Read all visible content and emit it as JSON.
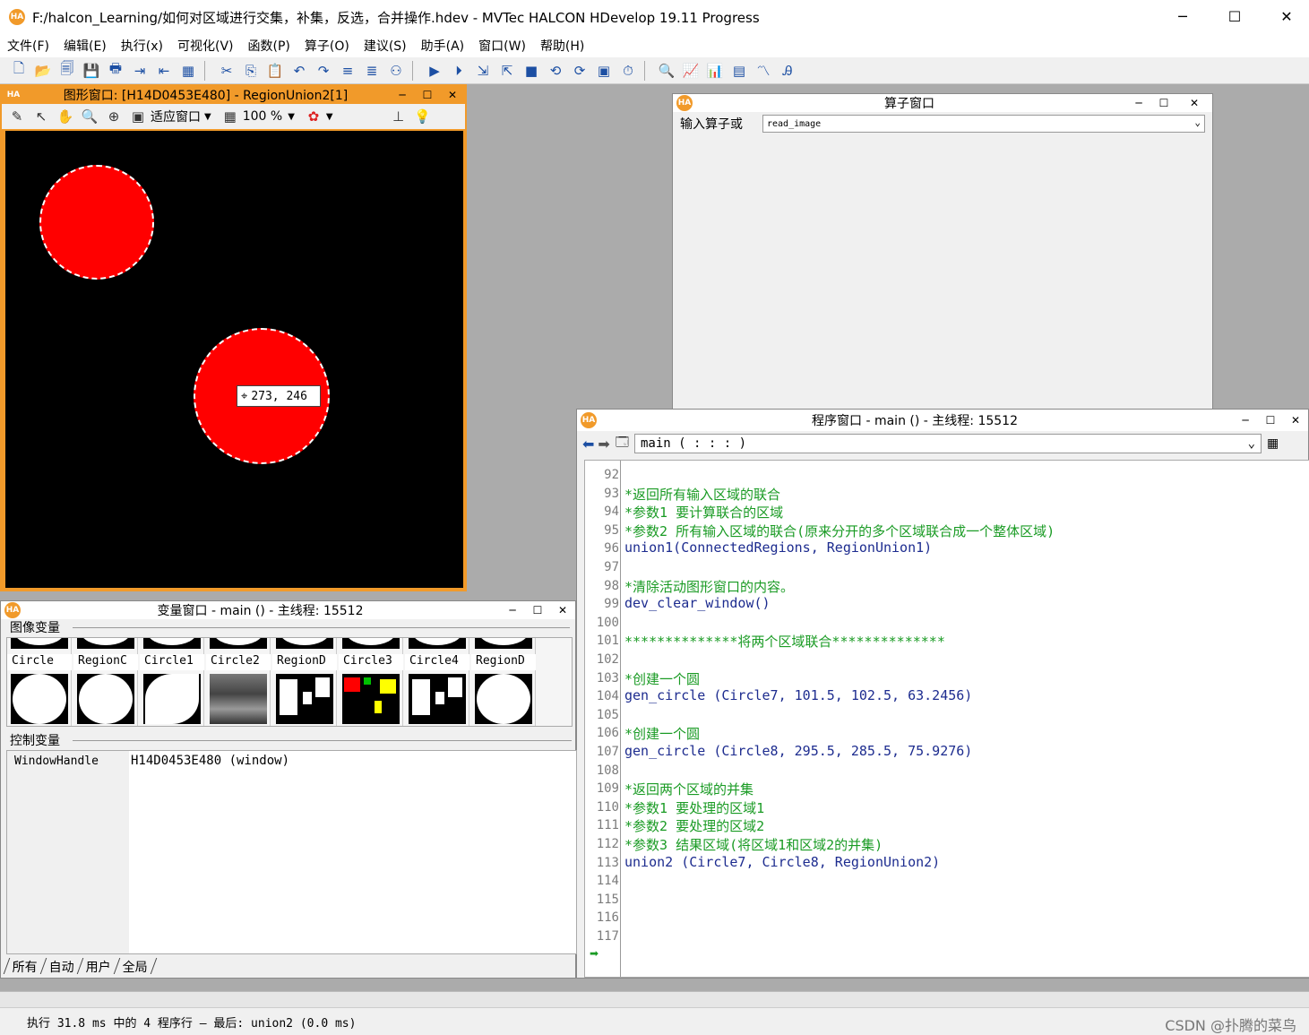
{
  "app": {
    "title": "F:/halcon_Learning/如何对区域进行交集，补集，反选，合并操作.hdev - MVTec HALCON HDevelop 19.11 Progress",
    "logo": "HA",
    "minimize": "─",
    "maximize": "☐",
    "close": "✕"
  },
  "menu": [
    "文件(F)",
    "编辑(E)",
    "执行(x)",
    "可视化(V)",
    "函数(P)",
    "算子(O)",
    "建议(S)",
    "助手(A)",
    "窗口(W)",
    "帮助(H)"
  ],
  "graphics_window": {
    "title": "图形窗口: [H14D0453E480] - RegionUnion2[1]",
    "fit_label": "适应窗口",
    "zoom_label": "100 %",
    "coordinate": "273, 246"
  },
  "operator_window": {
    "title": "算子窗口",
    "input_label": "输入算子或",
    "input_value": "read_image"
  },
  "program_window": {
    "title": "程序窗口 - main () - 主线程: 15512",
    "procedure": "main ( : : : )",
    "lines": [
      {
        "n": "92",
        "text": "",
        "kind": "code"
      },
      {
        "n": "93",
        "text": "*返回所有输入区域的联合",
        "kind": "comment"
      },
      {
        "n": "94",
        "text": "*参数1 要计算联合的区域",
        "kind": "comment"
      },
      {
        "n": "95",
        "text": "*参数2 所有输入区域的联合(原来分开的多个区域联合成一个整体区域)",
        "kind": "comment"
      },
      {
        "n": "96",
        "text": "union1(ConnectedRegions, RegionUnion1)",
        "kind": "code"
      },
      {
        "n": "97",
        "text": "",
        "kind": "code"
      },
      {
        "n": "98",
        "text": "*清除活动图形窗口的内容。",
        "kind": "comment"
      },
      {
        "n": "99",
        "text": "dev_clear_window()",
        "kind": "func"
      },
      {
        "n": "100",
        "text": "",
        "kind": "code"
      },
      {
        "n": "101",
        "text": "**************将两个区域联合**************",
        "kind": "comment"
      },
      {
        "n": "102",
        "text": "",
        "kind": "code"
      },
      {
        "n": "103",
        "text": "*创建一个圆",
        "kind": "comment"
      },
      {
        "n": "104",
        "text": "gen_circle (Circle7, 101.5, 102.5, 63.2456)",
        "kind": "code"
      },
      {
        "n": "105",
        "text": "",
        "kind": "code"
      },
      {
        "n": "106",
        "text": "*创建一个圆",
        "kind": "comment"
      },
      {
        "n": "107",
        "text": "gen_circle (Circle8, 295.5, 285.5, 75.9276)",
        "kind": "code"
      },
      {
        "n": "108",
        "text": "",
        "kind": "code"
      },
      {
        "n": "109",
        "text": "*返回两个区域的并集",
        "kind": "comment"
      },
      {
        "n": "110",
        "text": "*参数1 要处理的区域1",
        "kind": "comment"
      },
      {
        "n": "111",
        "text": "*参数2 要处理的区域2",
        "kind": "comment"
      },
      {
        "n": "112",
        "text": "*参数3 结果区域(将区域1和区域2的并集)",
        "kind": "comment"
      },
      {
        "n": "113",
        "text": "union2 (Circle7, Circle8, RegionUnion2)",
        "kind": "code"
      },
      {
        "n": "114",
        "text": "",
        "kind": "code"
      },
      {
        "n": "115",
        "text": "",
        "kind": "code"
      },
      {
        "n": "116",
        "text": "",
        "kind": "code"
      },
      {
        "n": "117",
        "text": "",
        "kind": "code"
      }
    ]
  },
  "variable_window": {
    "title": "变量窗口 - main () - 主线程: 15512",
    "image_section": "图像变量",
    "control_section": "控制变量",
    "images": [
      "Circle",
      "RegionC",
      "Circle1",
      "Circle2",
      "RegionD",
      "Circle3",
      "Circle4",
      "RegionD"
    ],
    "control_name": "WindowHandle",
    "control_value": "H14D0453E480 (window)",
    "tabs": [
      "所有",
      "自动",
      "用户",
      "全局"
    ]
  },
  "status": {
    "text": "执行 31.8 ms 中的 4 程序行 — 最后: union2 (0.0 ms)",
    "watermark": "CSDN @扑腾的菜鸟"
  },
  "colors": {
    "accent": "#f19a2a",
    "comment": "#1a9b24",
    "code": "#1d2c8f",
    "region": "#ff0000"
  }
}
